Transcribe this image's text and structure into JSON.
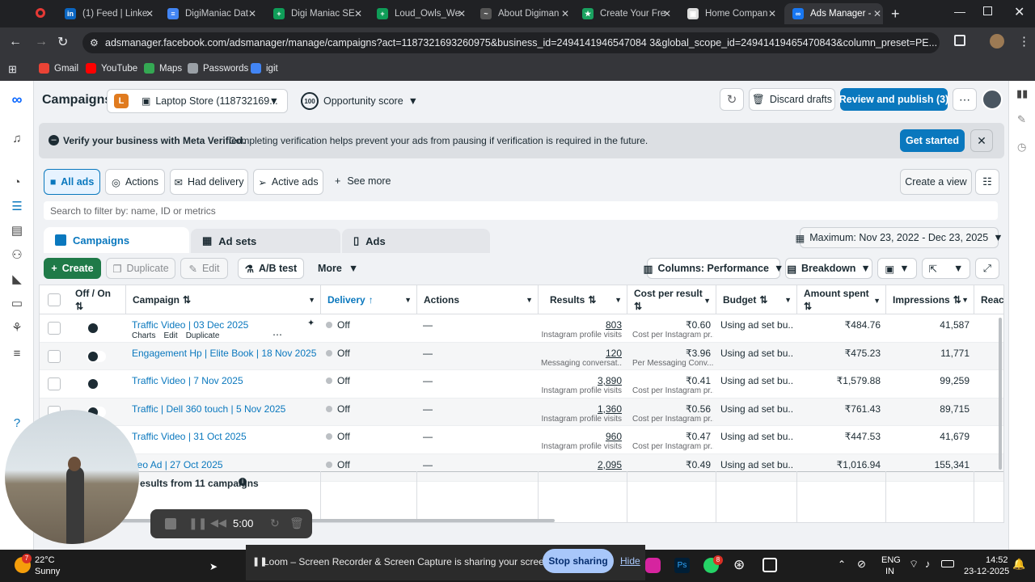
{
  "browser": {
    "tabs": [
      {
        "label": "(1) Feed | Linke",
        "color": "#0a66c2",
        "glyph": "in"
      },
      {
        "label": "DigiManiac Dat",
        "color": "#4285f4",
        "glyph": "≡"
      },
      {
        "label": "Digi Maniac SE",
        "color": "#0f9d58",
        "glyph": "+"
      },
      {
        "label": "Loud_Owls_We",
        "color": "#0f9d58",
        "glyph": "+"
      },
      {
        "label": "About Digiman",
        "color": "#555",
        "glyph": "~"
      },
      {
        "label": "Create Your Fre",
        "color": "#1aa260",
        "glyph": "★"
      },
      {
        "label": "Home Compan",
        "color": "#ddd",
        "glyph": "▣"
      },
      {
        "label": "Ads Manager -",
        "color": "#1877f2",
        "glyph": "∞"
      }
    ],
    "url": "adsmanager.facebook.com/adsmanager/manage/campaigns?act=1187321693260975&business_id=2494141946547084 3&global_scope_id=24941419465470843&column_preset=PE...",
    "bookmarks": [
      {
        "label": "Gmail",
        "color": "#ea4335"
      },
      {
        "label": "YouTube",
        "color": "#ff0000"
      },
      {
        "label": "Maps",
        "color": "#34a853"
      },
      {
        "label": "Passwords",
        "color": "#9aa0a6"
      },
      {
        "label": "igit",
        "color": "#4285f4"
      }
    ]
  },
  "header": {
    "title": "Campaigns",
    "account_initial": "L",
    "account_name": "Laptop Store (118732169...",
    "opportunity_badge": "100",
    "opportunity_label": "Opportunity score",
    "discard_label": "Discard drafts",
    "publish_label": "Review and publish (3)"
  },
  "banner": {
    "bold": "Verify your business with Meta Verified.",
    "text": "Completing verification helps prevent your ads from pausing if verification is required in the future.",
    "cta": "Get started"
  },
  "filters": {
    "chips": [
      "All ads",
      "Actions",
      "Had delivery",
      "Active ads"
    ],
    "see_more": "See more",
    "create_view": "Create a view",
    "search_placeholder": "Search to filter by: name, ID or metrics"
  },
  "level_tabs": [
    "Campaigns",
    "Ad sets",
    "Ads"
  ],
  "date_range": "Maximum: Nov 23, 2022 - Dec 23, 2025",
  "toolbar": {
    "create": "Create",
    "duplicate": "Duplicate",
    "edit": "Edit",
    "ab_test": "A/B test",
    "more": "More",
    "columns": "Columns: Performance",
    "breakdown": "Breakdown"
  },
  "columns": [
    "Off / On",
    "Campaign",
    "Delivery",
    "Actions",
    "Results",
    "Cost per result",
    "Budget",
    "Amount spent",
    "Impressions",
    "Reach"
  ],
  "row_actions": [
    "Charts",
    "Edit",
    "Duplicate"
  ],
  "rows": [
    {
      "name": "Traffic Video | 03 Dec 2025",
      "delivery": "Off",
      "actions": "—",
      "results": "803",
      "results_sub": "Instagram profile visits",
      "cost": "₹0.60",
      "cost_sub": "Cost per Instagram pr...",
      "budget": "Using ad set bu...",
      "spent": "₹484.76",
      "impressions": "41,587"
    },
    {
      "name": "Engagement Hp | Elite Book | 18 Nov 2025",
      "delivery": "Off",
      "actions": "—",
      "results": "120",
      "results_sub": "Messaging conversat...",
      "cost": "₹3.96",
      "cost_sub": "Per Messaging Conv...",
      "budget": "Using ad set bu...",
      "spent": "₹475.23",
      "impressions": "11,771"
    },
    {
      "name": "Traffic Video | 7 Nov 2025",
      "delivery": "Off",
      "actions": "—",
      "results": "3,890",
      "results_sub": "Instagram profile visits",
      "cost": "₹0.41",
      "cost_sub": "Cost per Instagram pr...",
      "budget": "Using ad set bu...",
      "spent": "₹1,579.88",
      "impressions": "99,259"
    },
    {
      "name": "Traffic | Dell 360 touch | 5 Nov 2025",
      "delivery": "Off",
      "actions": "—",
      "results": "1,360",
      "results_sub": "Instagram profile visits",
      "cost": "₹0.56",
      "cost_sub": "Cost per Instagram pr...",
      "budget": "Using ad set bu...",
      "spent": "₹761.43",
      "impressions": "89,715"
    },
    {
      "name": "Traffic Video | 31 Oct 2025",
      "delivery": "Off",
      "actions": "—",
      "results": "960",
      "results_sub": "Instagram profile visits",
      "cost": "₹0.47",
      "cost_sub": "Cost per Instagram pr...",
      "budget": "Using ad set bu...",
      "spent": "₹447.53",
      "impressions": "41,679"
    },
    {
      "name": "deo Ad | 27 Oct 2025",
      "delivery": "Off",
      "actions": "—",
      "results": "2,095",
      "results_sub": "",
      "cost": "₹0.49",
      "cost_sub": "",
      "budget": "Using ad set bu...",
      "spent": "₹1,016.94",
      "impressions": "155,341"
    }
  ],
  "footer_summary": "esults from 11 campaigns",
  "recorder": {
    "time": "5:00"
  },
  "loom": {
    "message": "Loom – Screen Recorder & Screen Capture is sharing your screen and audio.",
    "stop": "Stop sharing",
    "hide": "Hide"
  },
  "taskbar": {
    "weather_temp": "22°C",
    "weather_desc": "Sunny",
    "badge": "7",
    "lang1": "ENG",
    "lang2": "IN",
    "time": "14:52",
    "date": "23-12-2025",
    "notif_badge": "8"
  }
}
